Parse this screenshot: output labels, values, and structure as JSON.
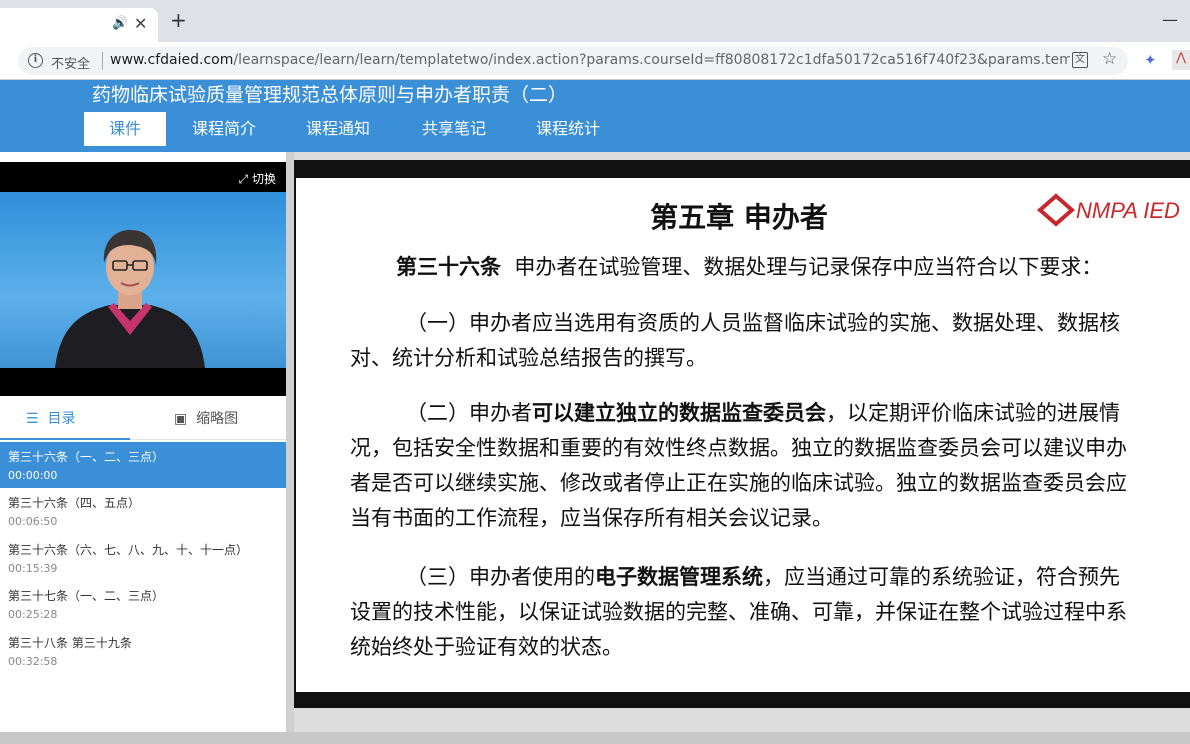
{
  "browser": {
    "address_security": "不安全",
    "url_host": "www.cfdaied.com",
    "url_path": "/learnspace/learn/learn/templatetwo/index.action?params.courseId=ff80808172c1dfa50172ca516f740f23&params.templl..."
  },
  "site": {
    "course_title": "药物临床试验质量管理规范总体原则与申办者职责（二）",
    "nav": [
      "课件",
      "课程简介",
      "课程通知",
      "共享笔记",
      "课程统计"
    ]
  },
  "player": {
    "switch_label": "切换"
  },
  "toc": {
    "tab_catalog": "目录",
    "tab_thumbnails": "缩略图",
    "items": [
      {
        "title": "第三十六条（一、二、三点）",
        "time": "00:00:00"
      },
      {
        "title": "第三十六条（四、五点）",
        "time": "00:06:50"
      },
      {
        "title": "第三十六条（六、七、八、九、十、十一点）",
        "time": "00:15:39"
      },
      {
        "title": "第三十七条（一、二、三点）",
        "time": "00:25:28"
      },
      {
        "title": "第三十八条 第三十九条",
        "time": "00:32:58"
      }
    ]
  },
  "slide": {
    "chapter": "第五章  申办者",
    "logo_text": "NMPA IED",
    "article_label": "第三十六条",
    "article_text": "申办者在试验管理、数据处理与记录保存中应当符合以下要求：",
    "p1": "（一）申办者应当选用有资质的人员监督临床试验的实施、数据处理、数据核对、统计分析和试验总结报告的撰写。",
    "p2_a": "（二）申办者",
    "p2_b": "可以建立独立的数据监查委员会",
    "p2_c": "，以定期评价临床试验的进展情况，包括安全性数据和重要的有效性终点数据。独立的数据监查委员会可以建议申办者是否可以继续实施、修改或者停止正在实施的临床试验。独立的数据监查委员会应当有书面的工作流程，应当保存所有相关会议记录。",
    "p3_a": "（三）申办者使用的",
    "p3_b": "电子数据管理系统",
    "p3_c": "，应当通过可靠的系统验证，符合预先设置的技术性能，以保证试验数据的完整、准确、可靠，并保证在整个试验过程中系统始终处于验证有效的状态。"
  }
}
